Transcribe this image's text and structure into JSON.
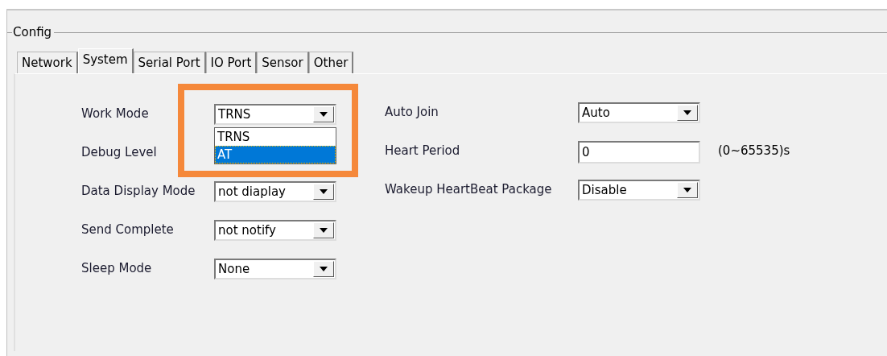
{
  "group": {
    "title": "Config"
  },
  "tabs": [
    {
      "label": "Network",
      "selected": false
    },
    {
      "label": "System",
      "selected": true
    },
    {
      "label": "Serial Port",
      "selected": false
    },
    {
      "label": "IO Port",
      "selected": false
    },
    {
      "label": "Sensor",
      "selected": false
    },
    {
      "label": "Other",
      "selected": false
    }
  ],
  "left_fields": [
    {
      "label": "Work Mode",
      "kind": "combo",
      "value": "TRNS",
      "options": [
        {
          "label": "TRNS",
          "highlighted": false
        },
        {
          "label": "AT",
          "highlighted": true
        }
      ]
    },
    {
      "label": "Debug Level",
      "kind": "covered"
    },
    {
      "label": "Data Display Mode",
      "kind": "combo",
      "value": "not diaplay"
    },
    {
      "label": "Send Complete",
      "kind": "combo",
      "value": "not notify"
    },
    {
      "label": "Sleep Mode",
      "kind": "combo",
      "value": "None"
    }
  ],
  "right_fields": [
    {
      "label": "Auto Join",
      "kind": "combo",
      "value": "Auto"
    },
    {
      "label": "Heart Period",
      "kind": "text",
      "value": "0",
      "hint": "(0~65535)s"
    },
    {
      "label": "Wakeup HeartBeat Package",
      "kind": "combo",
      "value": "Disable"
    }
  ],
  "annotation": {
    "kind": "highlight-frame"
  }
}
